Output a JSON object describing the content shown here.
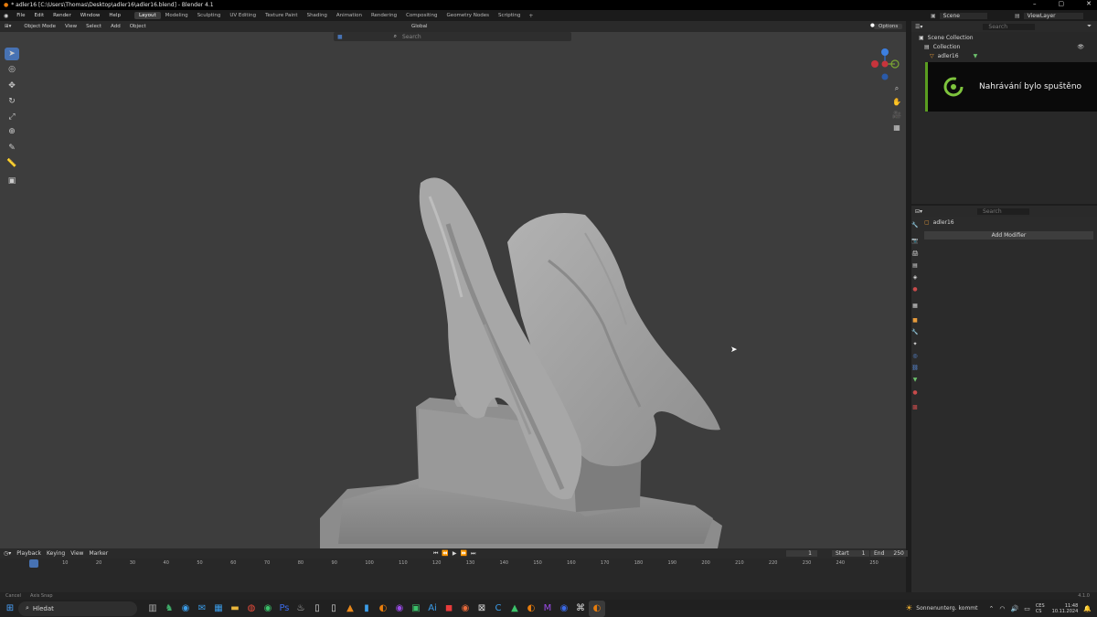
{
  "window": {
    "title": "* adler16 [C:\\Users\\Thomas\\Desktop\\adler16\\adler16.blend] - Blender 4.1",
    "min_icon": "minimize-icon",
    "max_icon": "maximize-icon",
    "close_icon": "close-icon"
  },
  "menu": {
    "items": [
      "File",
      "Edit",
      "Render",
      "Window",
      "Help"
    ],
    "workspaces": [
      "Layout",
      "Modeling",
      "Sculpting",
      "UV Editing",
      "Texture Paint",
      "Shading",
      "Animation",
      "Rendering",
      "Compositing",
      "Geometry Nodes",
      "Scripting"
    ],
    "active_workspace": "Layout",
    "scene": "Scene",
    "view_layer": "ViewLayer"
  },
  "viewport_header": {
    "mode": "Object Mode",
    "menus": [
      "View",
      "Select",
      "Add",
      "Object"
    ],
    "transform_orientation": "Global",
    "options": "Options",
    "search_placeholder": "Search"
  },
  "outliner": {
    "root": "Scene Collection",
    "collection": "Collection",
    "object": "adler16",
    "search_placeholder": "Search"
  },
  "notification": {
    "text": "Nahrávání bylo spuštěno"
  },
  "properties": {
    "search_placeholder": "Search",
    "object_name": "adler16",
    "add_modifier": "Add Modifier"
  },
  "timeline": {
    "menus": [
      "Playback",
      "Keying",
      "View",
      "Marker"
    ],
    "current_frame": "1",
    "start_label": "Start",
    "start": "1",
    "end_label": "End",
    "end": "250",
    "ticks": [
      "1",
      "10",
      "20",
      "30",
      "40",
      "50",
      "60",
      "70",
      "80",
      "90",
      "100",
      "110",
      "120",
      "130",
      "140",
      "150",
      "160",
      "170",
      "180",
      "190",
      "200",
      "210",
      "220",
      "230",
      "240",
      "250"
    ]
  },
  "status": {
    "left1": "Cancel",
    "left2": "Axis Snap",
    "version": "4.1.0"
  },
  "taskbar": {
    "search_placeholder": "Hledat",
    "weather": "Sonnenunterg. kommt",
    "lang1": "CES",
    "lang2": "CS",
    "time": "11:48",
    "date": "10.11.2024"
  },
  "colors": {
    "accent": "#4772b3",
    "toast_border": "#5a9d20",
    "viewport_bg": "#3d3d3d"
  }
}
